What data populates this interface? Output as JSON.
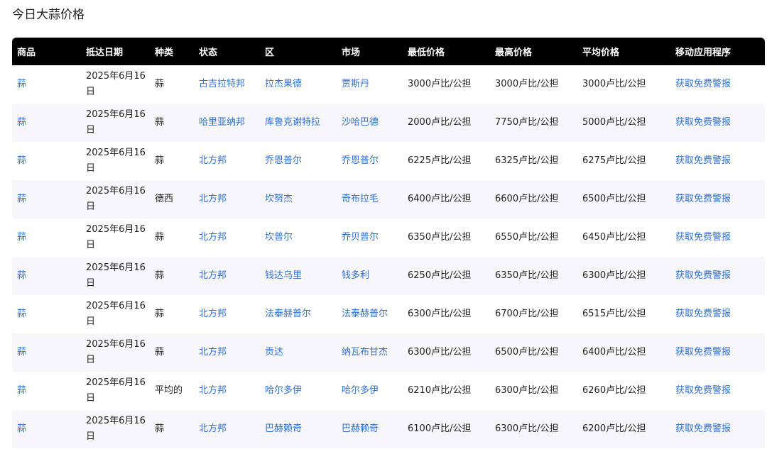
{
  "page": {
    "title": "今日大蒜价格"
  },
  "colors": {
    "link": "#2f6fd6",
    "header_bg": "#000000",
    "stripe": "#f6f6fb"
  },
  "table": {
    "headers": [
      "商品",
      "抵达日期",
      "种类",
      "状态",
      "区",
      "市场",
      "最低价格",
      "最高价格",
      "平均价格",
      "移动应用程序"
    ],
    "rows": [
      {
        "commodity": "蒜",
        "date": "2025年6月16日",
        "variety": "蒜",
        "state": "古吉拉特邦",
        "district": "拉杰果德",
        "market": "贾斯丹",
        "min": "3000卢比/公担",
        "max": "3000卢比/公担",
        "avg": "3000卢比/公担",
        "app": "获取免费警报"
      },
      {
        "commodity": "蒜",
        "date": "2025年6月16日",
        "variety": "蒜",
        "state": "哈里亚纳邦",
        "district": "库鲁克谢特拉",
        "market": "沙哈巴德",
        "min": "2000卢比/公担",
        "max": "7750卢比/公担",
        "avg": "5000卢比/公担",
        "app": "获取免费警报"
      },
      {
        "commodity": "蒜",
        "date": "2025年6月16日",
        "variety": "蒜",
        "state": "北方邦",
        "district": "乔恩普尔",
        "market": "乔恩普尔",
        "min": "6225卢比/公担",
        "max": "6325卢比/公担",
        "avg": "6275卢比/公担",
        "app": "获取免费警报"
      },
      {
        "commodity": "蒜",
        "date": "2025年6月16日",
        "variety": "德西",
        "state": "北方邦",
        "district": "坎努杰",
        "market": "奇布拉毛",
        "min": "6400卢比/公担",
        "max": "6600卢比/公担",
        "avg": "6500卢比/公担",
        "app": "获取免费警报"
      },
      {
        "commodity": "蒜",
        "date": "2025年6月16日",
        "variety": "蒜",
        "state": "北方邦",
        "district": "坎普尔",
        "market": "乔贝普尔",
        "min": "6350卢比/公担",
        "max": "6550卢比/公担",
        "avg": "6450卢比/公担",
        "app": "获取免费警报"
      },
      {
        "commodity": "蒜",
        "date": "2025年6月16日",
        "variety": "蒜",
        "state": "北方邦",
        "district": "钱达乌里",
        "market": "钱多利",
        "min": "6250卢比/公担",
        "max": "6350卢比/公担",
        "avg": "6300卢比/公担",
        "app": "获取免费警报"
      },
      {
        "commodity": "蒜",
        "date": "2025年6月16日",
        "variety": "蒜",
        "state": "北方邦",
        "district": "法泰赫普尔",
        "market": "法泰赫普尔",
        "min": "6300卢比/公担",
        "max": "6700卢比/公担",
        "avg": "6515卢比/公担",
        "app": "获取免费警报"
      },
      {
        "commodity": "蒜",
        "date": "2025年6月16日",
        "variety": "蒜",
        "state": "北方邦",
        "district": "贡达",
        "market": "纳瓦布甘杰",
        "min": "6300卢比/公担",
        "max": "6500卢比/公担",
        "avg": "6400卢比/公担",
        "app": "获取免费警报"
      },
      {
        "commodity": "蒜",
        "date": "2025年6月16日",
        "variety": "平均的",
        "state": "北方邦",
        "district": "哈尔多伊",
        "market": "哈尔多伊",
        "min": "6210卢比/公担",
        "max": "6300卢比/公担",
        "avg": "6260卢比/公担",
        "app": "获取免费警报"
      },
      {
        "commodity": "蒜",
        "date": "2025年6月16日",
        "variety": "蒜",
        "state": "北方邦",
        "district": "巴赫赖奇",
        "market": "巴赫赖奇",
        "min": "6100卢比/公担",
        "max": "6300卢比/公担",
        "avg": "6200卢比/公担",
        "app": "获取免费警报"
      }
    ]
  }
}
